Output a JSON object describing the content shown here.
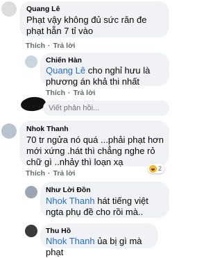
{
  "comments": [
    {
      "name": "Quang Lê",
      "text": "Phạt vậy không đủ sức răn đe phạt hẵn 7 tỉ vào"
    },
    {
      "name": "Chiến Hàn",
      "mention": "Quang Lê",
      "text": " cho nghỉ hưu là phương án khả thi nhất"
    },
    {
      "name": "Nhok Thanh",
      "text": "70 tr ngửa nó quá ...phải phạt hơn mới xứng .hát thì chẳng nghe rỏ chữ gì ..nhảy thì  loạn xạ",
      "reactions": "2"
    },
    {
      "name": "Như Lời Đồn",
      "mention": "Nhok Thanh",
      "text": " hát tiếng việt ngta phụ đề cho rồi mà.."
    },
    {
      "name": "Thu Hồ",
      "mention": "Nhok Thanh",
      "text": " ủa bị gì mà phạt"
    }
  ],
  "actions": {
    "like": "Thích",
    "reply": "Trả lời",
    "sep": "·"
  },
  "reply_placeholder": "Viết phản hồi...",
  "colors": {
    "bubble": "#f0f2f5",
    "mention": "#216fdb",
    "meta": "#65676b"
  }
}
